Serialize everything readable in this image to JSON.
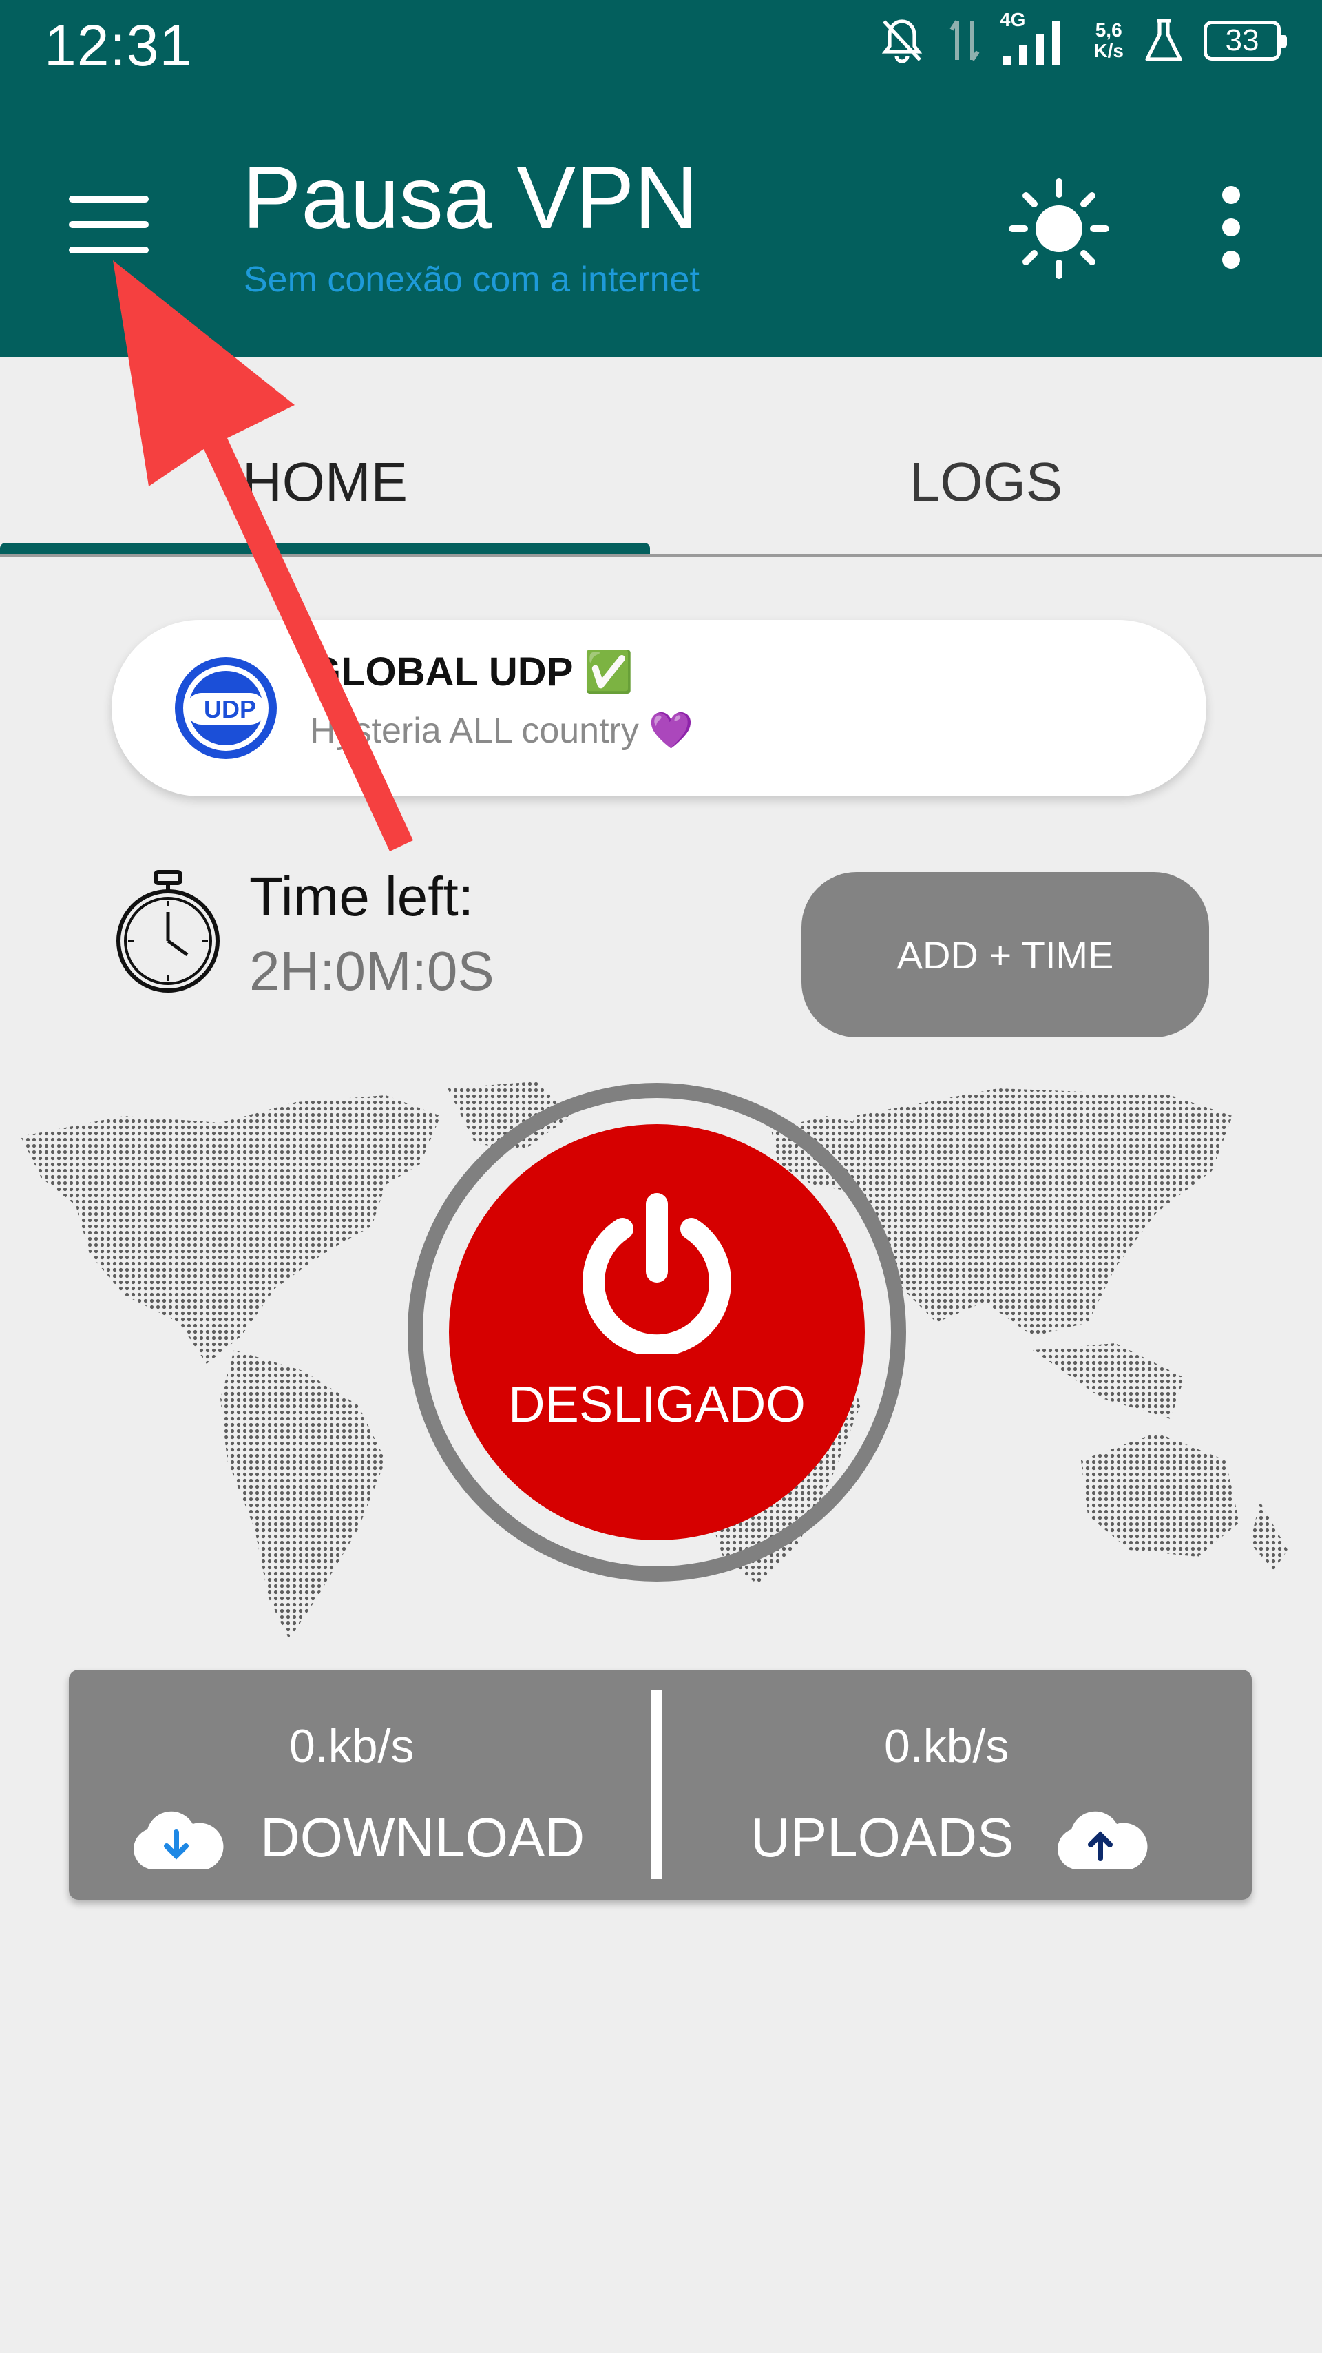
{
  "status_bar": {
    "time": "12:31",
    "net_speed_top": "5,6",
    "net_speed_bottom": "K/s",
    "network_type": "4G",
    "battery": "33"
  },
  "app_bar": {
    "title": "Pausa VPN",
    "subtitle": "Sem conexão com a internet"
  },
  "tabs": [
    {
      "label": "HOME",
      "selected": true
    },
    {
      "label": "LOGS",
      "selected": false
    }
  ],
  "server": {
    "name": "GLOBAL UDP ✅",
    "description": "Hysteria ALL country 💜",
    "logo_text": "UDP"
  },
  "timer": {
    "label": "Time left:",
    "value": "2H:0M:0S",
    "add_button_label": "ADD + TIME"
  },
  "connection": {
    "status_label": "DESLIGADO"
  },
  "stats": {
    "download": {
      "value": "0.kb/s",
      "label": "DOWNLOAD"
    },
    "upload": {
      "value": "0.kb/s",
      "label": "UPLOADS"
    }
  },
  "colors": {
    "app_bar": "#035f5d",
    "subtitle": "#1e9ad9",
    "power_button": "#d60000",
    "panel": "#838383",
    "annotation_arrow": "#f54040"
  }
}
